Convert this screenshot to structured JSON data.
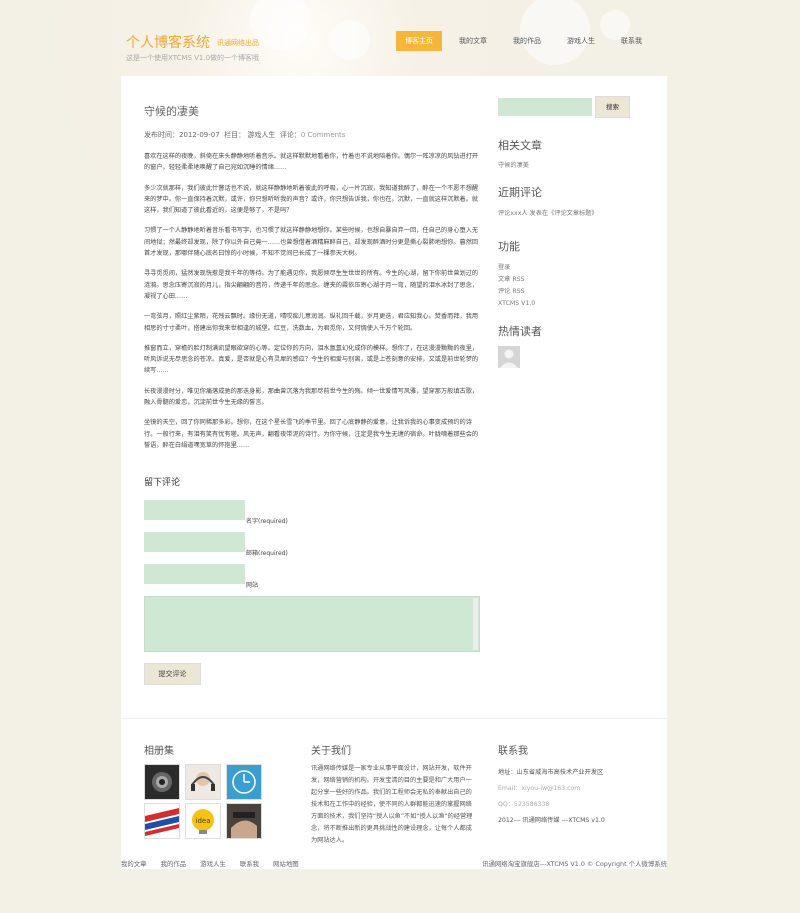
{
  "header": {
    "site_title": "个人博客系统",
    "site_subtitle": "讯通网络出品",
    "site_desc": "这是一个使用XTCMS V1.0做的一个博客哦",
    "nav": [
      "博客主页",
      "我的文章",
      "我的作品",
      "游戏人生",
      "联系我"
    ]
  },
  "post": {
    "title": "守候的凄美",
    "meta": {
      "time_label": "发布时间：",
      "time": "2012-09-07",
      "column_label": "栏目：",
      "column": "游戏人生",
      "comment_label": "评论：",
      "comments": "0 Comments"
    },
    "paragraphs": [
      "喜欢在这样的夜晚，斜倚在床头静静地听着音乐。就这样默默地看着你，竹着也不说地陪着你。偶尔一阵凉凉的风钻进打开的窗户，轻轻柔柔地唤醒了自己宛如沉睡的情绪……",
      "多少次就那样，我们彼此什瞥话也不说，就这样静静地听着彼此的呼吸，心一片沉寂，我知道我醉了，醉在一个不愿不想醒来的梦中。你一直保持着沉默，或许，你只想听听我的声音？或许，你只想告诉我，你也在。沉默，一直就这样沉默着。就这样，我们知道了彼此看近的，这便是够了，不是吗？",
      "习惯了一个人静静地听着音乐看书写字，也习惯了就这样静静地想你。某些时候，也想自暴自弃一回，任自己的身心堕入无间地狱；然最终却发现，除了你以外自己竟一……也曾想借着酒精麻醉自己，却发现醉酒时分更是撕心裂肺地想你。暮然回首才发现，那哪伴随心底名曰惊的小时候，不知不觉间已长成了一棵参天大树。",
      "寻寻觅觅间，猛然发现恍惹是我千年的等待。为了能遇见你，我愿倾尽生生世世的所有。今生的心湖，留下你前世曾划过的涟漪。思念压寄沉寂的月儿，指尖翩翩的音符，传递千年的思念。缠夹的霞依压寄心湖于月一弯，随望的泪水冰封了思念，凝视了心田……",
      "一弯弦月，照红尘紫陌，花残云飘时。缘份无道，晴哎痴儿意润润。纵礼回千载，岁月更迭，君应知我心。焚香而拜，我用相思的寸寸柔叶，搭建出你我来世相逢的城堡。红豆，洗数血，为君觅你，又何惆使入千万个轮回。",
      "推窗而立，穿檐的脸灯制满凯望眼欲穿的心等。定位你的方向，泪水氤氲幻化成你的模样。想你了，在这漫漫黝黝的夜里，听风诉说无尽思念的苍凉。真爱，是否就是心有灵犀的感应？今生的相爱与别离，或是上苍刻意的安排，又或是前世轮梦的续写……",
      "长夜漫漫时分，唯见你痛落成驰的那迭身影，那曲曾沉落为我那尽前世今生的殇。倾一世爱情写风雅，望穿那万般填古歌，融入骨髓的爱恋，沉淀前世今生无缘的誓言。",
      "坐镜的天空，回了你同稀那多彩。想你，在这个星长雪飞的季节里。回了心底静静的爱意，让我诉我的心事变成预约的诗行。一般行来，有泪有笑有忧有嗟。风无声，翻看夜带泥的诗行。为你守候，注定是我今生无缠的宿命。叶胧嘀着那些会的誓语，醉在白绢道嘿宽草的怀抱里……"
    ]
  },
  "comment_form": {
    "title": "留下评论",
    "name_label": "名字(required)",
    "email_label": "邮箱(required)",
    "website_label": "网站",
    "submit_label": "提交评论"
  },
  "sidebar": {
    "search_button": "搜索",
    "related_title": "相关文章",
    "related_item": "守候的凄美",
    "recent_title": "近期评论",
    "recent_item": "评论xxx人 发表在《评论文章标题》",
    "func_title": "功能",
    "func_items": [
      "登录",
      "文章 RSS",
      "评论 RSS",
      "XTCMS V1.0"
    ],
    "readers_title": "热情读者"
  },
  "footer": {
    "album_title": "相册集",
    "about_title": "关于我们",
    "about_text": "讯通网络传媒是一家专业从事平面设计，网站开发，软件开发，网络营销的机构。开发宝清的目的主要是和广大用户一起分享一些好的作品。我们的工程师会无私的奉献出自己的技术和在工作中的经验，使不同的人群都能迅速的掌握网络方面的技术，我们坚持“授人以鱼”不如“授人以渔”的经营理念，将不断推出新的更具挑战性的建设理念，让每个人都成为网站达人。",
    "contact_title": "联系我",
    "address": "地址：山东省威海市高技术产业开发区",
    "email": "Email：xiyou-iw@163.com",
    "qq": "QQ：523586338",
    "since": "2012--- 讯通网络传媒 ---XTCMS v1.0"
  },
  "bottom": {
    "links": [
      "我的文章",
      "我的作品",
      "游戏人生",
      "联系我",
      "网站地图"
    ],
    "copyright": "讯通网络淘宝旗舰店---XTCMS V1.0 © Copyright 个人微博系统"
  },
  "colors": {
    "accent": "#f5b73b",
    "field": "#cfe8d3",
    "button": "#ece6d5"
  }
}
